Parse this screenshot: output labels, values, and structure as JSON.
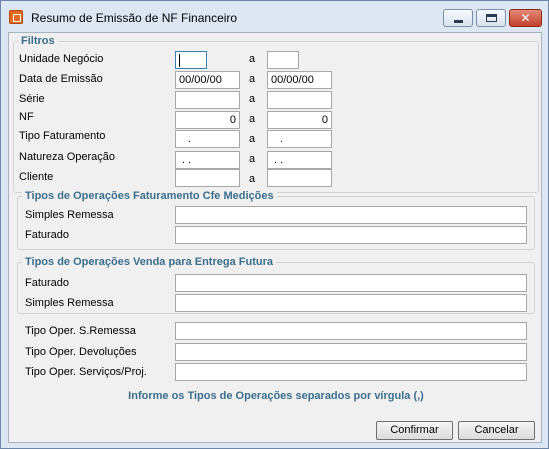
{
  "window": {
    "title": "Resumo de Emissão de NF Financeiro"
  },
  "filtros": {
    "title": "Filtros",
    "separator": "a",
    "unidade_negocio": {
      "label": "Unidade Negócio",
      "from": "",
      "to": ""
    },
    "data_emissao": {
      "label": "Data de Emissão",
      "from": "00/00/00",
      "to": "00/00/00"
    },
    "serie": {
      "label": "Série",
      "from": "",
      "to": ""
    },
    "nf": {
      "label": "NF",
      "from": "0",
      "to": "0"
    },
    "tipo_faturamento": {
      "label": "Tipo Faturamento",
      "from": ".",
      "to": "."
    },
    "natureza_operacao": {
      "label": "Natureza Operação",
      "from": ". .",
      "to": ". ."
    },
    "cliente": {
      "label": "Cliente",
      "from": "",
      "to": ""
    }
  },
  "medicoes": {
    "title": "Tipos de Operações Faturamento Cfe Medições",
    "simples_remessa": {
      "label": "Simples Remessa",
      "value": ""
    },
    "faturado": {
      "label": "Faturado",
      "value": ""
    }
  },
  "entrega_futura": {
    "title": "Tipos de Operações Venda para Entrega Futura",
    "faturado": {
      "label": "Faturado",
      "value": ""
    },
    "simples_remessa": {
      "label": "Simples Remessa",
      "value": ""
    }
  },
  "outros": {
    "s_remessa": {
      "label": "Tipo Oper. S.Remessa",
      "value": ""
    },
    "devolucoes": {
      "label": "Tipo Oper. Devoluções",
      "value": ""
    },
    "servicos": {
      "label": "Tipo Oper. Serviços/Proj.",
      "value": ""
    }
  },
  "hint": "Informe os Tipos de Operações separados por vírgula (,)",
  "buttons": {
    "confirm": "Confirmar",
    "cancel": "Cancelar"
  },
  "colors": {
    "accent": "#3b6e8e",
    "close": "#c3412c"
  }
}
